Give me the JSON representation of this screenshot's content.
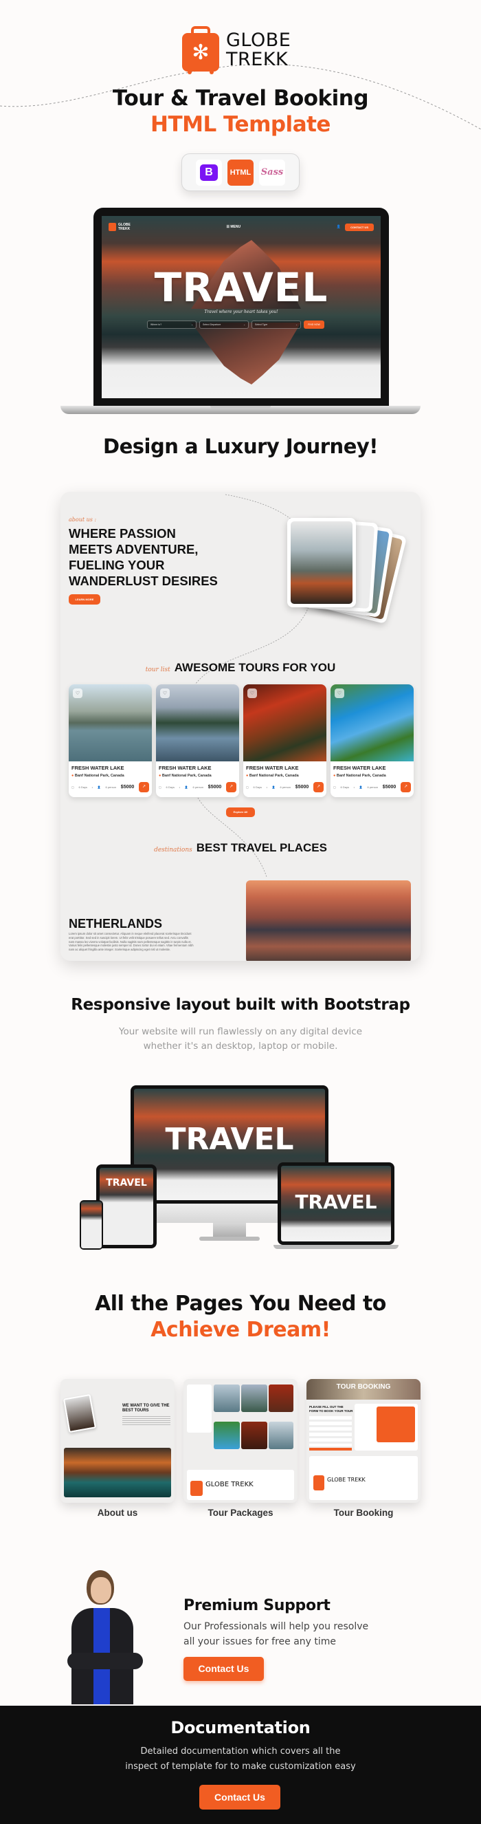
{
  "brand": {
    "name_line1": "GLOBE",
    "name_line2": "TREKK",
    "accent_color": "#f15d22",
    "logo_icon": "suitcase-palm-icon"
  },
  "hero": {
    "title_line1": "Tour & Travel Booking",
    "title_line2": "HTML Template",
    "tech_badges": [
      {
        "icon": "bootstrap-icon",
        "label": "B"
      },
      {
        "icon": "html5-icon",
        "label": "HTML"
      },
      {
        "icon": "sass-icon",
        "label": "Sass"
      }
    ]
  },
  "laptop_preview": {
    "nav_logo_line1": "GLOBE",
    "nav_logo_line2": "TREKK",
    "nav_menu": "MENU",
    "nav_cta": "CONTACT US",
    "hero_word": "TRAVEL",
    "tagline": "Travel where your heart takes you!",
    "search_fields": [
      "Where to?",
      "Select Departure",
      "Select Type"
    ],
    "search_button": "FIND NOW"
  },
  "luxury": {
    "heading": "Design a Luxury Journey!",
    "about_label": "about us :",
    "about_title_lines": [
      "WHERE PASSION",
      "MEETS ADVENTURE,",
      "FUELING YOUR",
      "WANDERLUST DESIRES"
    ],
    "learn_more": "LEARN MORE",
    "tours_label": "tour list",
    "tours_heading": "AWESOME TOURS FOR YOU",
    "tours": [
      {
        "name": "FRESH WATER LAKE",
        "location": "Banf National Park, Canada",
        "days": "6 Days",
        "persons": "6 person",
        "price": "$5000"
      },
      {
        "name": "FRESH WATER LAKE",
        "location": "Banf National Park, Canada",
        "days": "6 Days",
        "persons": "6 person",
        "price": "$5000"
      },
      {
        "name": "FRESH WATER LAKE",
        "location": "Banf National Park, Canada",
        "days": "6 Days",
        "persons": "6 person",
        "price": "$5000"
      },
      {
        "name": "FRESH WATER LAKE",
        "location": "Banf National Park, Canada",
        "days": "6 Days",
        "persons": "6 person",
        "price": "$5000"
      }
    ],
    "explore_all": "Explore All",
    "places_label": "destinations",
    "places_heading": "BEST TRAVEL PLACES",
    "place_title": "NETHERLANDS",
    "place_text": "Lorem ipsum dolor sit amet consectetur. Aliquam in neque eleifend placerat scelerisque tincidunt erat porttitor. Sed sed in suscipit lorem. Ut felis velit tristique posuere tellus sed. Arcu convallis nam massa leo viverra volutpat facilisis. Nulla sagittis nam pellentesque sagittis in turpis nulla et. Varius felis pellentesque molestie justo semper id. Donec tortor dui et etiam. Vitae fermentum nibh nam ac aliquet fringilla ante integer. Scelerisque adipiscing eget nisl ut molestie."
  },
  "responsive": {
    "heading": "Responsive layout built with Bootstrap",
    "sub_line1": "Your website will run flawlessly on any digital device",
    "sub_line2": "whether it's an desktop, laptop or mobile.",
    "device_word": "TRAVEL"
  },
  "pages": {
    "heading_line1": "All the Pages You Need to",
    "heading_line2": "Achieve Dream!",
    "items": [
      {
        "label": "About us",
        "thumb_title": "WE WANT TO GIVE THE BEST TOURS"
      },
      {
        "label": "Tour Packages",
        "thumb_title": "GLOBE TREKK"
      },
      {
        "label": "Tour Booking",
        "thumb_title": "TOUR BOOKING"
      }
    ],
    "booking_form_title": "PLEASE FILL OUT THE FORM TO BOOK YOUR TOUR"
  },
  "support": {
    "title": "Premium Support",
    "text_line1": "Our Professionals  will help you resolve",
    "text_line2": "all your issues for free any time",
    "button": "Contact Us"
  },
  "documentation": {
    "title": "Documentation",
    "text_line1": "Detailed documentation which covers all the",
    "text_line2": "inspect of template for to make customization easy",
    "button": "Contact Us"
  }
}
